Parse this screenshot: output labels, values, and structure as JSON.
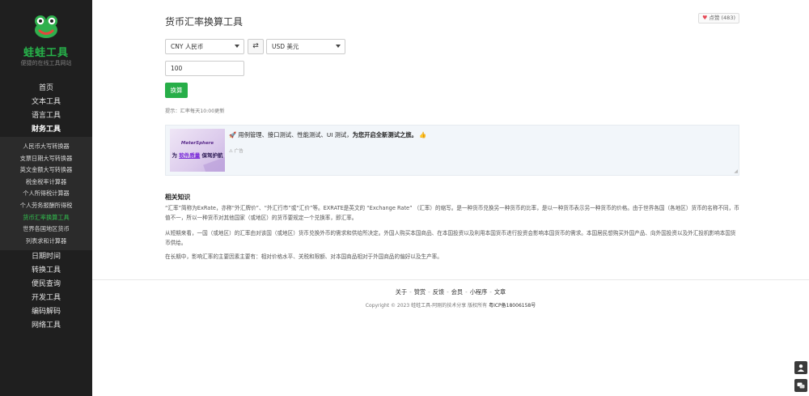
{
  "brand": {
    "name": "蛙蛙工具",
    "tagline": "便捷的在线工具网站"
  },
  "nav": {
    "top_items": [
      "首页",
      "文本工具",
      "语言工具"
    ],
    "current_group": "财务工具",
    "sub_items": [
      "人民币大写转换器",
      "支票日期大写转换器",
      "英文金额大写转换器",
      "税金税率计算器",
      "个人所得税计算器",
      "个人劳务报酬所得税",
      "货币汇率换算工具",
      "世界各国地区货币",
      "列表求和计算器"
    ],
    "active_sub": "货币汇率换算工具",
    "bottom_items": [
      "日期时间",
      "转换工具",
      "便民查询",
      "开发工具",
      "编码解码",
      "网络工具"
    ]
  },
  "page": {
    "title": "货币汇率换算工具",
    "like_label": "点赞",
    "like_count": "(483)",
    "from_currency": "CNY 人民币",
    "to_currency": "USD 美元",
    "swap_symbol": "⇄",
    "amount": "100",
    "convert_label": "换算",
    "hint": "提示：汇率每天10:00更新"
  },
  "ad": {
    "image_brand": "MeterSphere",
    "slogan_prefix": "为",
    "slogan_highlight": "软件质量",
    "slogan_suffix": "保驾护航",
    "text": "🚀 用例管理、接口测试、性能测试、UI 测试，",
    "text_bold": "为您开启全新测试之旅。",
    "text_emoji": "👍",
    "label": "广告"
  },
  "knowledge": {
    "title": "相关知识",
    "paragraphs": [
      "“汇率”简称为ExRate，亦称“外汇牌价”、“外汇行市”或“汇价”等。EXRATE是英文的 “Exchange Rate” （汇率）的缩写。是一种货币兑换另一种货币的比率，是以一种货币表示另一种货币的价格。由于世界各国（各地区）货币的名称不同，币值不一，所以一种货币对其他国家（或地区）的货币要规定一个兑换率，即汇率。",
      "从短期来看，一国（或地区）的汇率由对该国（或地区）货币兑换外币的需求和供给所决定。外国人购买本国商品、在本国投资以及利用本国货币进行投资会影响本国货币的需求。本国居民想购买外国产品、向外国投资以及外汇投机影响本国货币供给。",
      "在长期中，影响汇率的主要因素主要有：相对价格水平、关税和限额、对本国商品相对于外国商品的偏好以及生产率。"
    ]
  },
  "footer": {
    "links": [
      "关于",
      "赞赏",
      "反馈",
      "会员",
      "小程序",
      "文章"
    ],
    "separator": "-",
    "copyright": "Copyright © 2023 蛙蛙工具-阿刚的技术分享 版权所有",
    "icp": "粤ICP备18006158号"
  },
  "colors": {
    "sidebar_bg": "#1f1f1f",
    "brand_green": "#27b24a",
    "button_green": "#27ae48",
    "active_green": "#32c14f"
  },
  "icons": [
    "frog-logo-icon",
    "heart-icon",
    "swap-icon",
    "warning-icon",
    "user-icon",
    "chat-icon"
  ]
}
